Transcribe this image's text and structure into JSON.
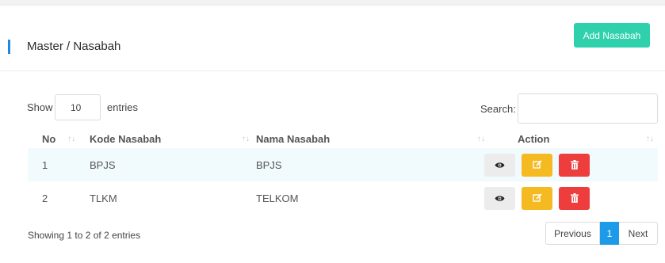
{
  "header": {
    "title": "Master / Nasabah",
    "add_button": "Add Nasabah"
  },
  "controls": {
    "show_label": "Show",
    "entries_value": "10",
    "entries_label": "entries",
    "search_label": "Search:",
    "search_value": ""
  },
  "table": {
    "columns": [
      "No",
      "Kode Nasabah",
      "Nama Nasabah",
      "Action"
    ],
    "rows": [
      {
        "no": "1",
        "kode": "BPJS",
        "nama": "BPJS"
      },
      {
        "no": "2",
        "kode": "TLKM",
        "nama": "TELKOM"
      }
    ],
    "actions": [
      "eye-icon",
      "edit-icon",
      "trash-icon"
    ]
  },
  "footer": {
    "info": "Showing 1 to 2 of 2 entries",
    "prev": "Previous",
    "page": "1",
    "next": "Next"
  },
  "colors": {
    "accent": "#1e88e5",
    "add_button": "#2fd0ac",
    "edit": "#f5b922",
    "delete": "#ee3d3d",
    "view": "#ececec",
    "active_page": "#1e9be8"
  }
}
